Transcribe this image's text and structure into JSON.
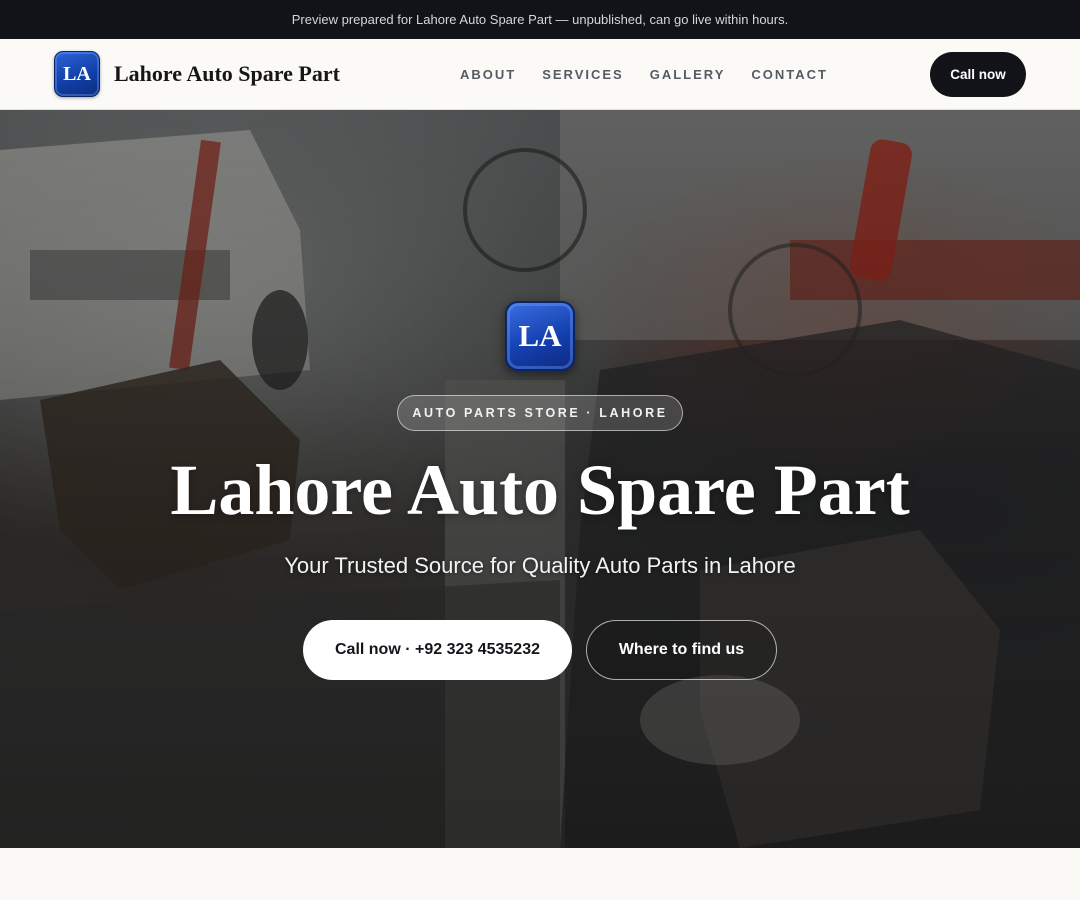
{
  "banner": {
    "text": "Preview prepared for Lahore Auto Spare Part — unpublished, can go live within hours."
  },
  "header": {
    "logo_text": "LA",
    "brand_name": "Lahore Auto Spare Part",
    "nav": [
      "ABOUT",
      "SERVICES",
      "GALLERY",
      "CONTACT"
    ],
    "cta_label": "Call now"
  },
  "hero": {
    "logo_text": "LA",
    "eyebrow": "AUTO PARTS STORE · LAHORE",
    "title": "Lahore Auto Spare Part",
    "subtitle": "Your Trusted Source for Quality Auto Parts in Lahore",
    "primary_button": "Call now · +92 323 4535232",
    "secondary_button": "Where to find us",
    "background_image": "auto-parts-workshop-photo"
  },
  "colors": {
    "banner_bg": "#111318",
    "logo_blue": "#1a4cc0",
    "cta_dark": "#121319",
    "page_bg": "#faf9f6"
  }
}
